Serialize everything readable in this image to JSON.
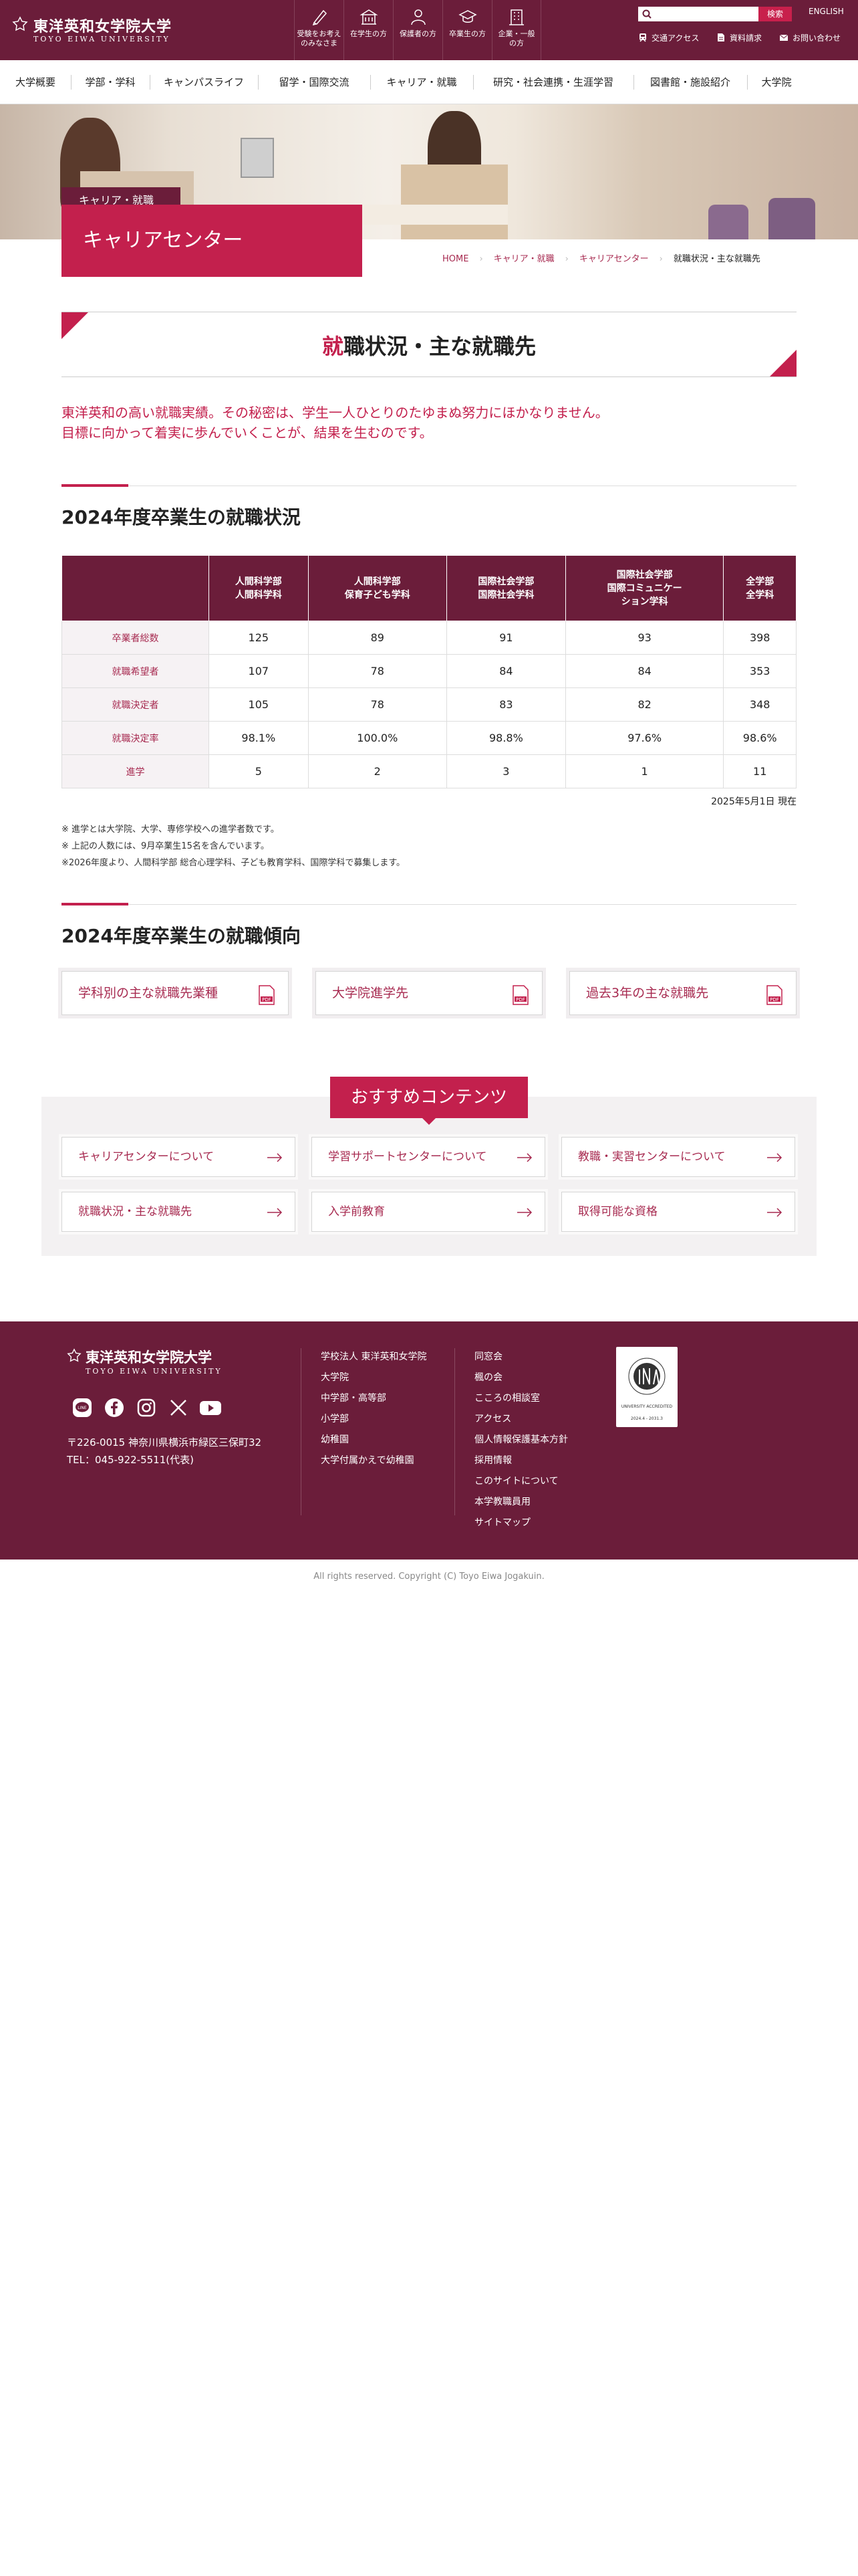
{
  "header": {
    "logo_jp": "東洋英和女学院大学",
    "logo_en": "TOYO EIWA UNIVERSITY",
    "targets": [
      "受験をお考え\nのみなさま",
      "在学生の方",
      "保護者の方",
      "卒業生の方",
      "企業・一般\nの方"
    ],
    "search_placeholder": "",
    "search_button": "検索",
    "english": "ENGLISH",
    "utility": [
      "交通アクセス",
      "資料請求",
      "お問い合わせ"
    ]
  },
  "global_nav": [
    "大学概要",
    "学部・学科",
    "キャンパスライフ",
    "留学・国際交流",
    "キャリア・就職",
    "研究・社会連携・生涯学習",
    "図書館・施設紹介",
    "大学院"
  ],
  "banner": {
    "category": "キャリア・就職",
    "title": "キャリアセンター"
  },
  "breadcrumb": [
    "HOME",
    "キャリア・就職",
    "キャリアセンター",
    "就職状況・主な就職先"
  ],
  "page": {
    "title_accent": "就",
    "title_rest": "職状況・主な就職先",
    "lead_1": "東洋英和の高い就職実績。その秘密は、学生一人ひとりのたゆまぬ努力にほかなりません。",
    "lead_2": "目標に向かって着実に歩んでいくことが、結果を生むのです。"
  },
  "section1": {
    "heading": "2024年度卒業生の就職状況",
    "columns": [
      "人間科学部\n人間科学科",
      "人間科学部\n保育子ども学科",
      "国際社会学部\n国際社会学科",
      "国際社会学部\n国際コミュニケー\nション学科",
      "全学部\n全学科"
    ],
    "rows": [
      {
        "label": "卒業者総数",
        "values": [
          "125",
          "89",
          "91",
          "93",
          "398"
        ]
      },
      {
        "label": "就職希望者",
        "values": [
          "107",
          "78",
          "84",
          "84",
          "353"
        ]
      },
      {
        "label": "就職決定者",
        "values": [
          "105",
          "78",
          "83",
          "82",
          "348"
        ]
      },
      {
        "label": "就職決定率",
        "values": [
          "98.1%",
          "100.0%",
          "98.8%",
          "97.6%",
          "98.6%"
        ]
      },
      {
        "label": "進学",
        "values": [
          "5",
          "2",
          "3",
          "1",
          "11"
        ]
      }
    ],
    "as_of": "2025年5月1日 現在",
    "notes": [
      "※ 進学とは大学院、大学、専修学校への進学者数です。",
      "※ 上記の人数には、9月卒業生15名を含んでいます。",
      "※2026年度より、人間科学部 総合心理学科、子ども教育学科、国際学科で募集します。"
    ]
  },
  "section2": {
    "heading": "2024年度卒業生の就職傾向",
    "pdf_links": [
      "学科別の主な就職先業種",
      "大学院進学先",
      "過去3年の主な就職先"
    ]
  },
  "recommended": {
    "tag": "おすすめコンテンツ",
    "links": [
      "キャリアセンターについて",
      "学習サポートセンターについて",
      "教職・実習センターについて",
      "就職状況・主な就職先",
      "入学前教育",
      "取得可能な資格"
    ]
  },
  "footer": {
    "logo_jp": "東洋英和女学院大学",
    "logo_en": "TOYO EIWA UNIVERSITY",
    "sns": [
      "line-icon",
      "facebook-icon",
      "instagram-icon",
      "x-icon",
      "youtube-icon"
    ],
    "address": "〒226-0015 神奈川県横浜市緑区三保町32",
    "tel": "TEL：045-922-5511(代表)",
    "col1": [
      "学校法人 東洋英和女学院",
      "大学院",
      "中学部・高等部",
      "小学部",
      "幼稚園",
      "大学付属かえで幼稚園"
    ],
    "col2": [
      "同窓会",
      "楓の会",
      "こころの相談室",
      "アクセス",
      "個人情報保護基本方針",
      "採用情報",
      "このサイトについて",
      "本学教職員用",
      "サイトマップ"
    ],
    "badge_text": "UNIVERSITY ACCREDITED",
    "badge_year": "2024.4 - 2031.3",
    "copyright": "All rights reserved. Copyright (C) Toyo Eiwa Jogakuin."
  },
  "colors": {
    "brand": "#6b1d3a",
    "accent": "#c3204d"
  }
}
